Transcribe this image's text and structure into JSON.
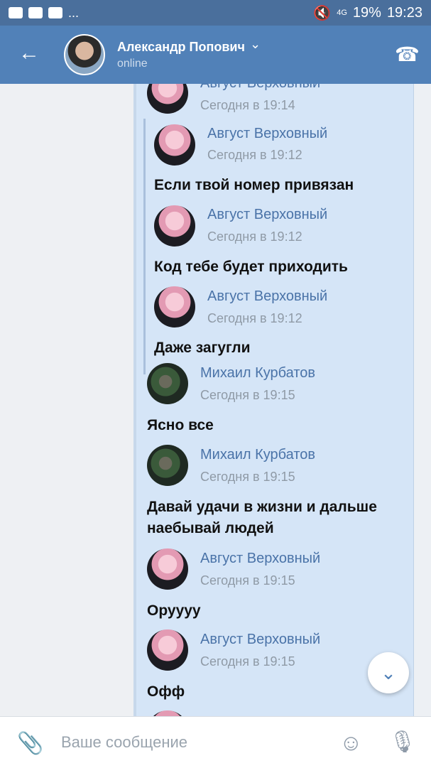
{
  "status_bar": {
    "left_icons": [
      "image-icon",
      "youtube-icon",
      "youtube-icon"
    ],
    "dots": "...",
    "network": "4G",
    "battery": "19%",
    "time": "19:23"
  },
  "header": {
    "back_icon": "←",
    "name": "Александр Попович",
    "chevron": "⌄",
    "status": "online",
    "phone_icon": "☎"
  },
  "messages": {
    "top": {
      "author": "Август Верховный",
      "time": "Сегодня в 19:14"
    },
    "f1": {
      "author": "Август Верховный",
      "time": "Сегодня в 19:12",
      "text": "Если твой номер привязан"
    },
    "f2": {
      "author": "Август Верховный",
      "time": "Сегодня в 19:12",
      "text": "Код тебе будет приходить"
    },
    "f3": {
      "author": "Август Верховный",
      "time": "Сегодня в 19:12",
      "text": "Даже загугли"
    },
    "m1": {
      "author": "Михаил Курбатов",
      "time": "Сегодня в 19:15",
      "text": "Ясно все"
    },
    "m2": {
      "author": "Михаил Курбатов",
      "time": "Сегодня в 19:15",
      "text": "Давай удачи в жизни и дальше наебывай людей"
    },
    "a1": {
      "author": "Август Верховный",
      "time": "Сегодня в 19:15",
      "text": "Оруууу"
    },
    "a2": {
      "author": "Август Верховный",
      "time": "Сегодня в 19:15",
      "text": "Офф"
    }
  },
  "scroll_down_icon": "⌄",
  "composer": {
    "placeholder": "Ваше сообщение",
    "clip_icon": "📎",
    "smile_icon": "☺",
    "mic_icon": "🎙"
  }
}
